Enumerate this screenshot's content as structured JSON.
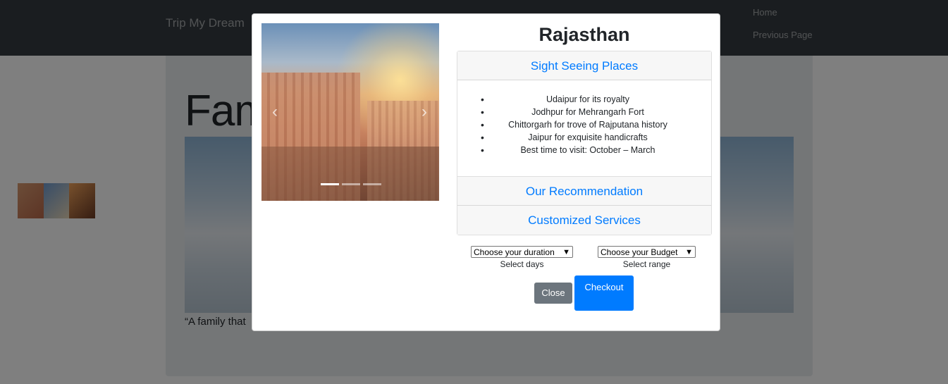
{
  "navbar": {
    "brand": "Trip My Dream",
    "links": [
      "Home",
      "Previous Page"
    ]
  },
  "page": {
    "heading": "Fam",
    "quote": "“A family that"
  },
  "modal": {
    "title": "Rajasthan",
    "carousel": {
      "prev_icon": "chevron-left-icon",
      "next_icon": "chevron-right-icon",
      "prev_glyph": "‹",
      "next_glyph": "›",
      "slide_count": 3,
      "active_slide": 1
    },
    "accordion": {
      "sections": [
        "Sight Seeing Places",
        "Our Recommendation",
        "Customized Services"
      ],
      "sightseeing_items": [
        "Udaipur for its royalty",
        "Jodhpur for Mehrangarh Fort",
        "Chittorgarh for trove of Rajputana history",
        "Jaipur for exquisite handicrafts",
        "Best time to visit: October – March"
      ]
    },
    "duration": {
      "selected": "Choose your duration",
      "label": "Select days",
      "arrow": "▼"
    },
    "budget": {
      "selected": "Choose your Budget",
      "label": "Select range",
      "arrow": "▼"
    },
    "buttons": {
      "close": "Close",
      "checkout": "Checkout"
    }
  },
  "colors": {
    "primary": "#007bff",
    "secondary": "#6c757d",
    "navbar": "#343a40"
  }
}
